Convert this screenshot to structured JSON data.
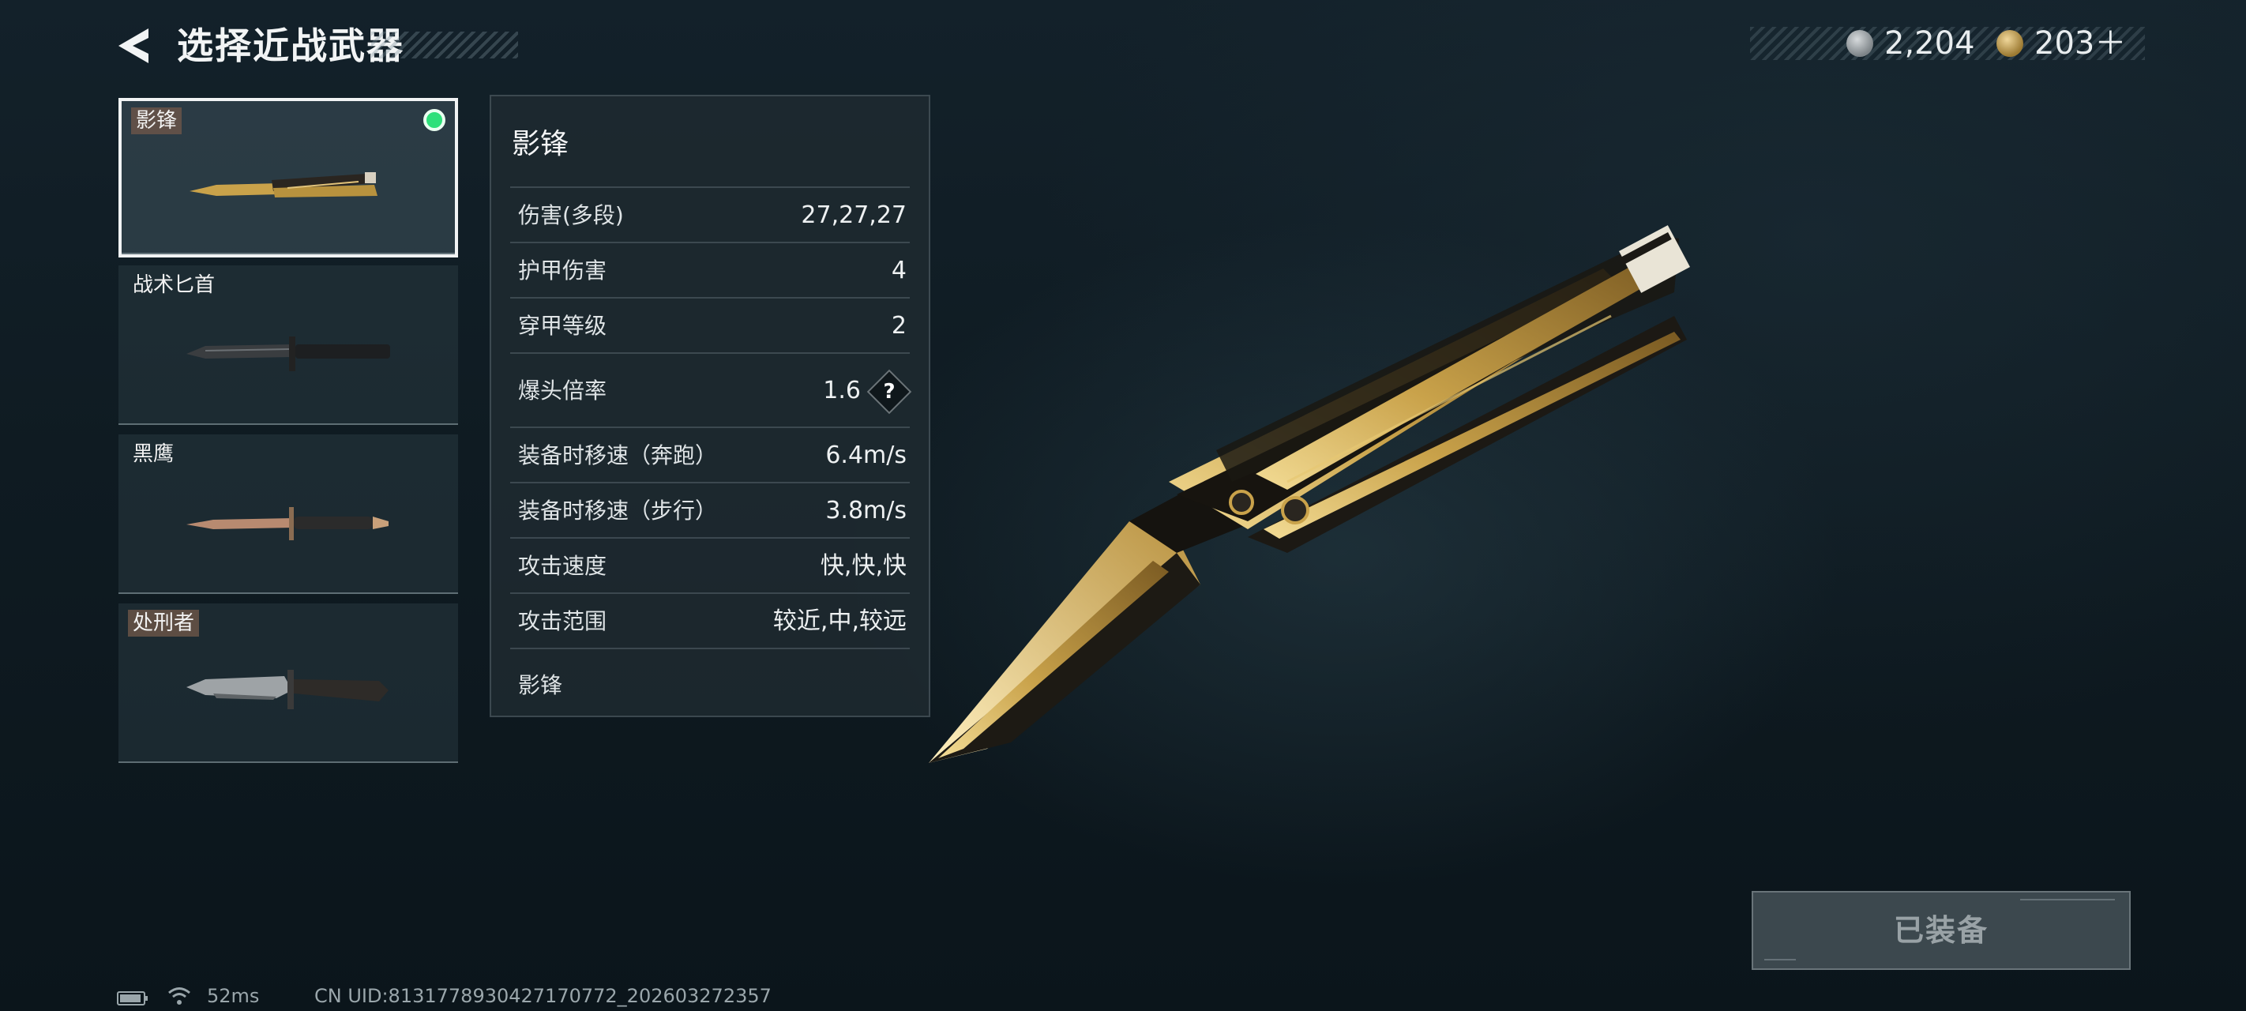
{
  "header": {
    "title": "选择近战武器",
    "currencies": [
      {
        "icon": "silver-coin-icon",
        "value": "2,204"
      },
      {
        "icon": "gold-coin-icon",
        "value": "203＋"
      }
    ]
  },
  "weapons": [
    {
      "name": "影锋",
      "selected": true,
      "equipped": true
    },
    {
      "name": "战术匕首",
      "selected": false,
      "equipped": false
    },
    {
      "name": "黑鹰",
      "selected": false,
      "equipped": false
    },
    {
      "name": "处刑者",
      "selected": false,
      "equipped": false
    }
  ],
  "stats": {
    "title": "影锋",
    "rows": [
      {
        "label": "伤害(多段)",
        "value": "27,27,27"
      },
      {
        "label": "护甲伤害",
        "value": "4"
      },
      {
        "label": "穿甲等级",
        "value": "2"
      },
      {
        "label": "爆头倍率",
        "value": "1.6"
      },
      {
        "label": "装备时移速（奔跑）",
        "value": "6.4m/s"
      },
      {
        "label": "装备时移速（步行）",
        "value": "3.8m/s"
      },
      {
        "label": "攻击速度",
        "value": "快,快,快"
      },
      {
        "label": "攻击范围",
        "value": "较近,中,较远"
      }
    ],
    "help_glyph": "?",
    "footer": "影锋"
  },
  "equip_button": {
    "label": "已装备"
  },
  "status_bar": {
    "ping": "52ms",
    "uid": "CN UID:8131778930427170772_202603272357"
  },
  "colors": {
    "equipped_dot": "#2ee07a",
    "gold": "#c9a24a",
    "background": "#0f1b22"
  }
}
